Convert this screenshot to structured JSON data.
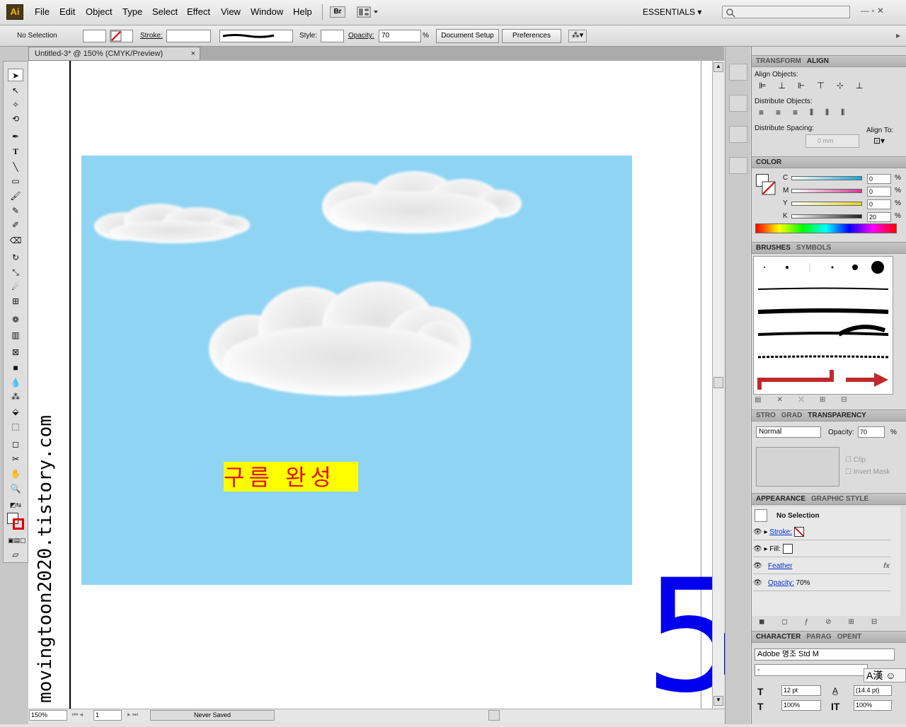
{
  "app": {
    "logo": "Ai"
  },
  "menu": [
    "File",
    "Edit",
    "Object",
    "Type",
    "Select",
    "Effect",
    "View",
    "Window",
    "Help"
  ],
  "workspace": "ESSENTIALS",
  "window_controls": "— ▫ ✕",
  "control": {
    "selection": "No Selection",
    "stroke_label": "Stroke:",
    "style_label": "Style:",
    "opacity_label": "Opacity:",
    "opacity_value": "70",
    "opacity_unit": "%",
    "document_setup": "Document Setup",
    "preferences": "Preferences"
  },
  "doc_tab": {
    "title": "Untitled-3* @ 150% (CMYK/Preview)",
    "close": "×"
  },
  "canvas": {
    "label_text": "구름 완성",
    "watermark": "movingtoon2020.tistory.com",
    "step_number": "5",
    "sky_color": "#8fd4f3",
    "label_bg": "#ffff00",
    "label_color": "#e01020",
    "step_color": "#0000ee"
  },
  "status": {
    "zoom": "150%",
    "page": "1",
    "save_state": "Never Saved"
  },
  "align_panel": {
    "tabs": [
      "TRANSFORM",
      "ALIGN"
    ],
    "align_objects": "Align Objects:",
    "distribute_objects": "Distribute Objects:",
    "distribute_spacing": "Distribute Spacing:",
    "align_to": "Align To:",
    "spacing_value": "0 mm"
  },
  "color_panel": {
    "title": "COLOR",
    "channels": [
      {
        "name": "C",
        "value": "0",
        "unit": "%"
      },
      {
        "name": "M",
        "value": "0",
        "unit": "%"
      },
      {
        "name": "Y",
        "value": "0",
        "unit": "%"
      },
      {
        "name": "K",
        "value": "20",
        "unit": "%"
      }
    ]
  },
  "brushes_panel": {
    "tabs": [
      "BRUSHES",
      "SYMBOLS"
    ]
  },
  "transparency_panel": {
    "tabs": [
      "STRO",
      "GRAD",
      "TRANSPARENCY"
    ],
    "blend_mode": "Normal",
    "opacity_label": "Opacity:",
    "opacity_value": "70",
    "opacity_unit": "%",
    "clip": "Clip",
    "invert_mask": "Invert Mask"
  },
  "appearance_panel": {
    "tabs": [
      "APPEARANCE",
      "GRAPHIC STYLE"
    ],
    "header": "No Selection",
    "rows": [
      {
        "label": "Stroke:"
      },
      {
        "label": "Fill:"
      },
      {
        "label": "Feather",
        "fx": "fx"
      },
      {
        "label": "Opacity:",
        "value": "70%"
      }
    ]
  },
  "character_panel": {
    "tabs": [
      "CHARACTER",
      "PARAG",
      "OPENT"
    ],
    "font_family": "Adobe 명조 Std M",
    "font_style": "-",
    "ime": "A漢",
    "size": "12 pt",
    "leading": "(14.4 pt)",
    "hscale": "100%",
    "vscale": "100%"
  }
}
